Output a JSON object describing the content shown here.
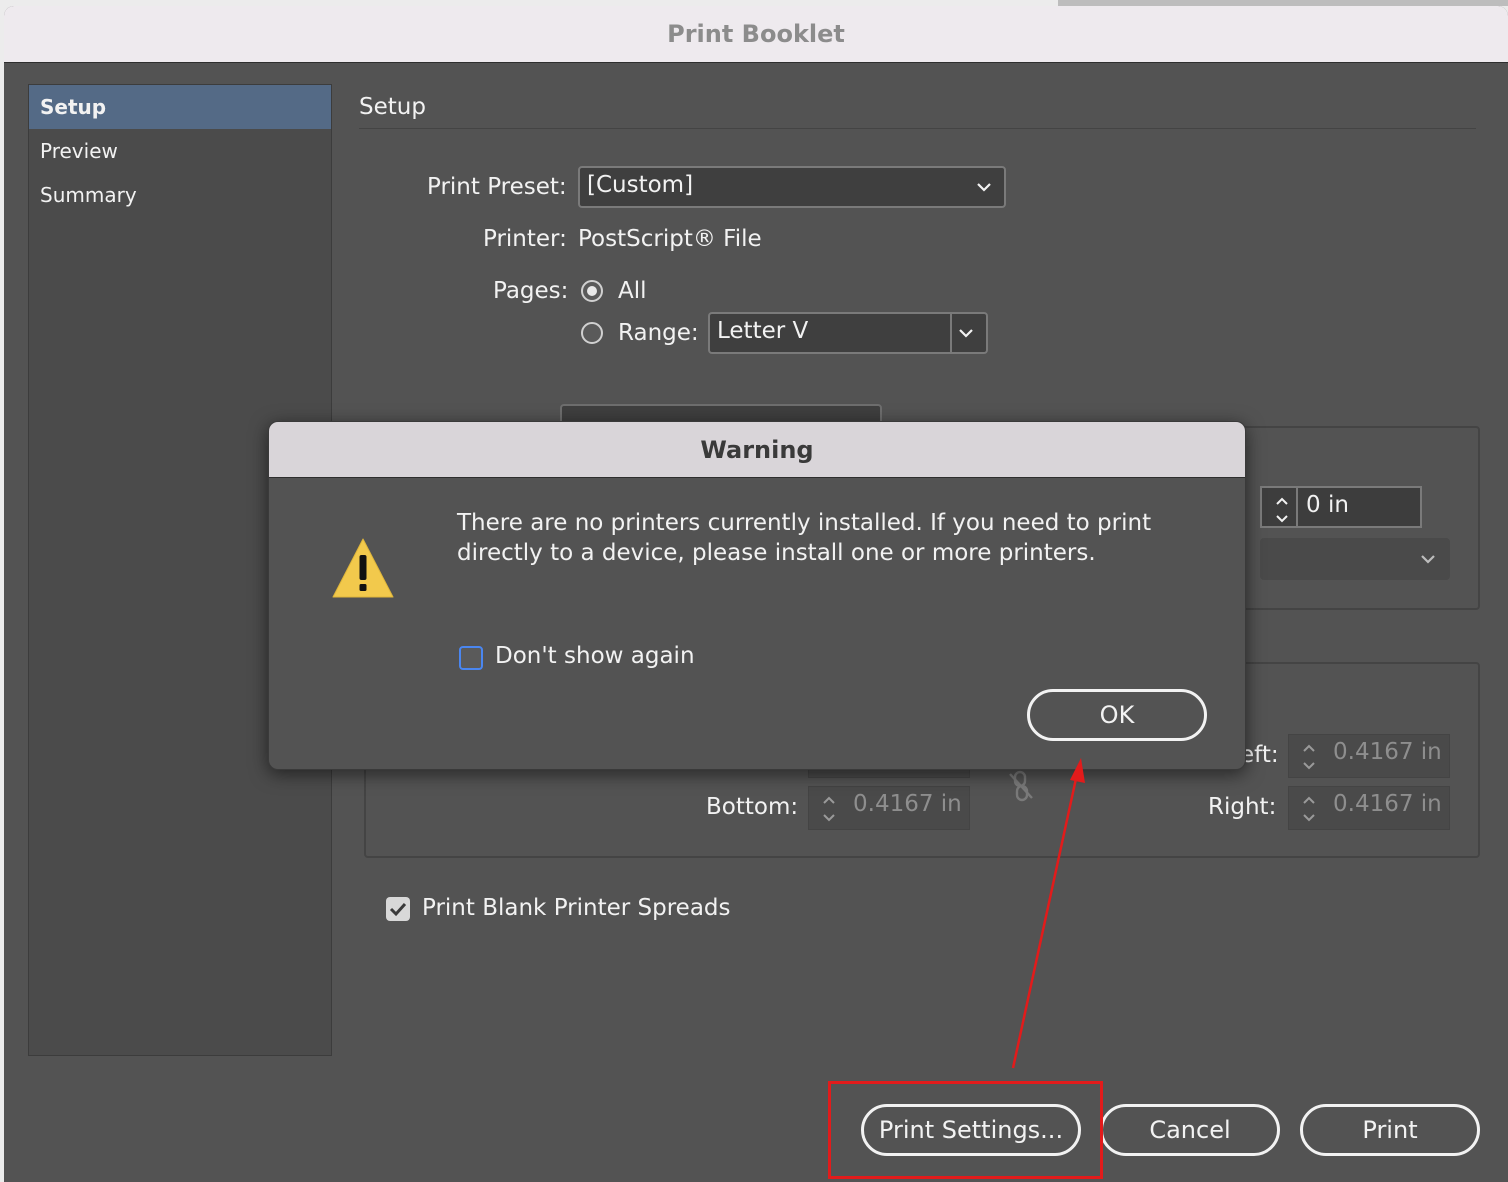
{
  "window": {
    "title": "Print Booklet"
  },
  "sidebar": {
    "items": [
      {
        "label": "Setup",
        "active": true
      },
      {
        "label": "Preview",
        "active": false
      },
      {
        "label": "Summary",
        "active": false
      }
    ]
  },
  "setup": {
    "section_title": "Setup",
    "print_preset_label": "Print Preset:",
    "print_preset_value": "[Custom]",
    "printer_label": "Printer:",
    "printer_value": "PostScript® File",
    "pages_label": "Pages:",
    "all_label": "All",
    "range_label": "Range:",
    "range_value": "Letter V",
    "creep_value": "0 in",
    "margins": {
      "left_label": "eft:",
      "left_value": "0.4167 in",
      "bottom_label": "Bottom:",
      "bottom_value": "0.4167 in",
      "right_label": "Right:",
      "right_value": "0.4167 in"
    },
    "print_blank_label": "Print Blank Printer Spreads",
    "print_blank_checked": true
  },
  "buttons": {
    "print_settings": "Print Settings...",
    "cancel": "Cancel",
    "print": "Print"
  },
  "warning": {
    "title": "Warning",
    "message": "There are no printers currently installed.  If you need to print directly to a device, please install one or more printers.",
    "dont_show_label": "Don't show again",
    "ok_label": "OK"
  },
  "colors": {
    "annotation": "#e21b1b",
    "accent": "#546a86",
    "warning_icon": "#f2c94c"
  }
}
